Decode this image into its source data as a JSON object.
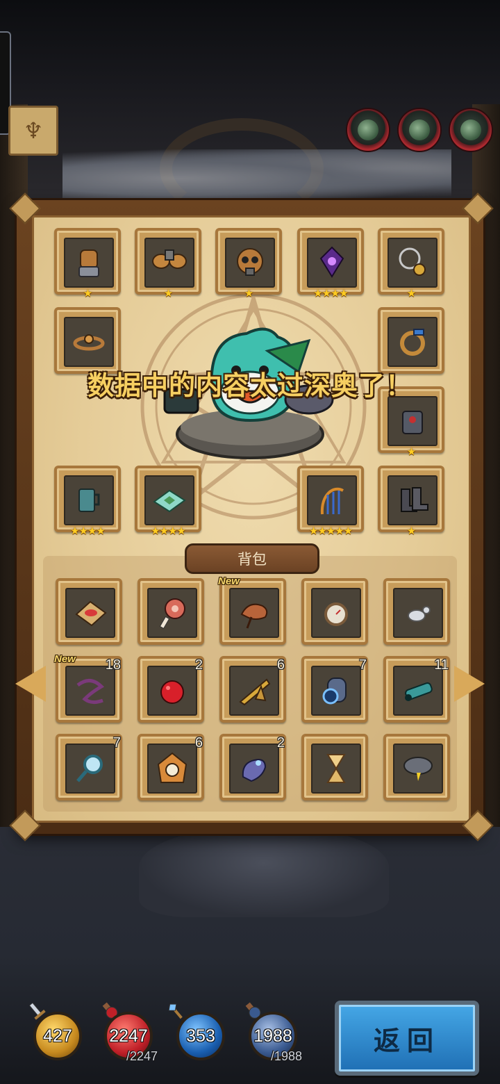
{
  "banner": "数据中的内容太过深奥了！",
  "bag_tab_label": "背包",
  "back_button_label": "返回",
  "new_label": "New",
  "colors": {
    "gold": "#f6cf61",
    "panel": "#e5cc98",
    "button": "#2a86cc"
  },
  "equipment": [
    {
      "name": "gauntlet",
      "icon": "gauntlet-icon",
      "stars": "★"
    },
    {
      "name": "shoulder-pads",
      "icon": "shoulder-armor-icon",
      "stars": "★"
    },
    {
      "name": "gas-mask-helmet",
      "icon": "helmet-icon",
      "stars": "★"
    },
    {
      "name": "purple-lantern",
      "icon": "lantern-icon",
      "stars": "★★★★"
    },
    {
      "name": "amulet",
      "icon": "amulet-icon",
      "stars": "★"
    },
    {
      "name": "gear-bracelet",
      "icon": "bracelet-icon",
      "stars": ""
    },
    {
      "name": "ring",
      "icon": "ring-icon",
      "stars": ""
    },
    {
      "name": "chest-armor",
      "icon": "chest-armor-icon",
      "stars": "★"
    },
    {
      "name": "mug",
      "icon": "mug-icon",
      "stars": "★★★★"
    },
    {
      "name": "map-box",
      "icon": "map-icon",
      "stars": "★★★★"
    },
    {
      "name": "harp-bow",
      "icon": "harp-icon",
      "stars": "★★★★★"
    },
    {
      "name": "boots",
      "icon": "boots-icon",
      "stars": "★"
    }
  ],
  "bag": [
    {
      "name": "lips-book",
      "icon": "book-icon",
      "count": "",
      "new": false
    },
    {
      "name": "meat",
      "icon": "meat-icon",
      "count": "",
      "new": false
    },
    {
      "name": "chameleon",
      "icon": "chameleon-icon",
      "count": "",
      "new": true
    },
    {
      "name": "pocket-watch",
      "icon": "compass-icon",
      "count": "",
      "new": false
    },
    {
      "name": "silver-beads",
      "icon": "beads-icon",
      "count": "",
      "new": false
    },
    {
      "name": "rope",
      "icon": "rope-icon",
      "count": "18",
      "new": true
    },
    {
      "name": "red-fruit",
      "icon": "fruit-icon",
      "count": "2",
      "new": false
    },
    {
      "name": "horn",
      "icon": "horn-icon",
      "count": "6",
      "new": false
    },
    {
      "name": "cannon-core",
      "icon": "cannon-icon",
      "count": "7",
      "new": false
    },
    {
      "name": "ray-gun",
      "icon": "blaster-icon",
      "count": "11",
      "new": false
    },
    {
      "name": "magnifier",
      "icon": "magnifier-icon",
      "count": "7",
      "new": false
    },
    {
      "name": "cuckoo-clock",
      "icon": "clock-icon",
      "count": "6",
      "new": false
    },
    {
      "name": "glove",
      "icon": "glove-icon",
      "count": "2",
      "new": false
    },
    {
      "name": "hourglass",
      "icon": "hourglass-icon",
      "count": "",
      "new": false
    },
    {
      "name": "storm-cloud",
      "icon": "cloud-icon",
      "count": "",
      "new": false
    }
  ],
  "hud": {
    "attack": "427",
    "hp": "2247",
    "hp_max": "/2247",
    "mana": "353",
    "armor": "1988",
    "armor_max": "/1988"
  }
}
